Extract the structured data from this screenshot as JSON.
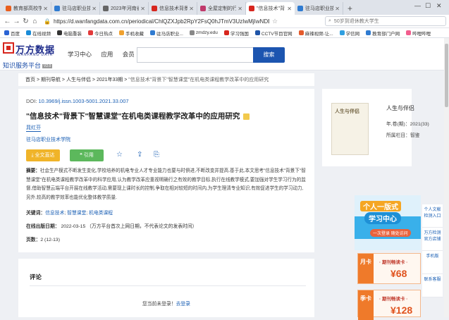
{
  "browser": {
    "tabs": [
      {
        "label": "教育部高校学",
        "color": "#e95f1f"
      },
      {
        "label": "驻马店职业技",
        "color": "#2f7bd1"
      },
      {
        "label": "2023年河南省",
        "color": "#666666"
      },
      {
        "label": "信息技术背景",
        "color": "#d7261e"
      },
      {
        "label": "全屋定制的行",
        "color": "#c0396b"
      },
      {
        "label": "\"信息技术\"背",
        "color": "#d7261e"
      },
      {
        "label": "驻马店职业技",
        "color": "#2f7bd1"
      }
    ],
    "new_tab": "+",
    "url": "https://d.wanfangdata.com.cn/periodical/ChlQZXJpb2RpY2FsQ0hJTmV3UzIwMjIwNDE1E",
    "search_placeholder": "50岁到退休教大学生",
    "bookmarks": [
      {
        "label": "百度",
        "color": "#2a63d4"
      },
      {
        "label": "在线视频",
        "color": "#1a8cd8"
      },
      {
        "label": "电脑重装",
        "color": "#333333"
      },
      {
        "label": "今日热点",
        "color": "#e23b3b"
      },
      {
        "label": "手机收藏",
        "color": "#f0a12f"
      },
      {
        "label": "驻马店职业...",
        "color": "#2f7bd1"
      },
      {
        "label": "zmdzy.edu",
        "color": "#888888"
      },
      {
        "label": "学习强国",
        "color": "#d7261e"
      },
      {
        "label": "CCTV节目官网",
        "color": "#1f55a8"
      },
      {
        "label": "麻辣视频-让...",
        "color": "#e45b2c"
      },
      {
        "label": "学信网",
        "color": "#2f9fe0"
      },
      {
        "label": "教育部门户网",
        "color": "#2f7bd1"
      },
      {
        "label": "哔哩哔哩",
        "color": "#f25d8e"
      }
    ]
  },
  "header": {
    "logo_cn": "万方数据",
    "logo_en": "WANFANG DATA",
    "logo_sub": "知识服务平台",
    "logo_ver": "V2.0",
    "nav": [
      "学习中心",
      "应用",
      "会员"
    ],
    "search_button": "搜索"
  },
  "breadcrumb": {
    "items": [
      "首页",
      "期刊导航",
      "人生与伴侣",
      "2021年33期"
    ],
    "current": "\"信息技术\"背景下\"智慧课堂\"在机电类课程教学改革中的应用研究"
  },
  "article": {
    "doi_label": "DOI:",
    "doi_value": "10.3969/j.issn.1003-5001.2021.33.007",
    "title": "\"信息技术\"背景下\"智慧课堂\"在机电类课程教学改革中的应用研究",
    "author": "晁红芬",
    "affiliation": "驻马店职业技术学院",
    "download_label": "全文直达",
    "cite_label": "引用",
    "abstract_label": "摘要：",
    "abstract": "社会生产模式不断发生变化,学校培养的机电专业人才专业能力也要与时俱进,不断改变并提高.基于此,本文思考\"信息技术\"背景下\"智慧课堂\"在机电类课程教学改革中的科学应用,认为教学改革应重视明确行之有效的教学目标,执行在线教学模式,要加强对学生学习行为的监督,借助智慧云端平台开展在线教学活动,需要现上课时长的控制,争取在相对较短的时间内,为学生理清专业知识,有效促进学生的学习动力,另外,较高的教学效率也能优化整体教学质量.",
    "keywords_label": "关键词：",
    "keywords": [
      "信息技术",
      "智慧课堂",
      "机电类课程"
    ],
    "pub_date_label": "在线出版日期：",
    "pub_date": "2022-03-15",
    "pub_date_note": "（万方平台首次上网日期，不代表论文的发表时间）",
    "pages_label": "页数：",
    "pages": "2 (12-13)"
  },
  "comments": {
    "title": "评论",
    "login_text": "您当前未登录！",
    "login_link": "去登录"
  },
  "journal": {
    "cover_title": "人生与伴侣",
    "name": "人生与伴侣",
    "year_label": "年,卷(期)：",
    "year": "2021(33)",
    "column_label": "所属栏目：",
    "column": "智鉴"
  },
  "ad": {
    "line1": "个人一版式",
    "line2": "学习中心",
    "line3": "一次登录 随处访问"
  },
  "promos": [
    {
      "tag": "月卡",
      "title": "· 期刊畅读卡 ·",
      "price": "¥68"
    },
    {
      "tag": "季卡",
      "title": "· 期刊畅读卡 ·",
      "price": "¥128"
    }
  ],
  "right_nav": [
    "个人文献检测入口",
    "万方检测官方店铺",
    "手机版",
    "联系客服"
  ]
}
